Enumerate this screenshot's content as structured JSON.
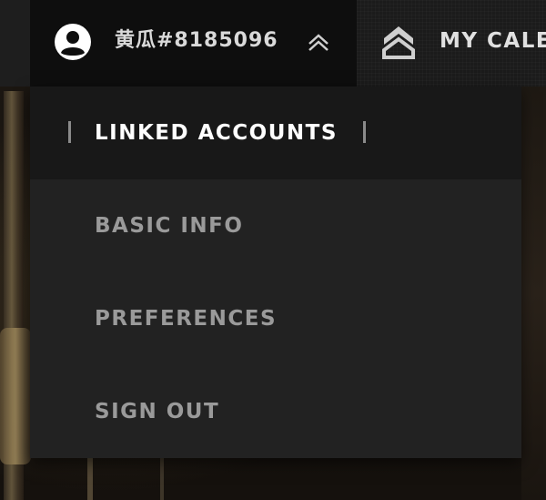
{
  "header": {
    "username": "黄瓜#8185096",
    "calendar_label": "MY CALE"
  },
  "dropdown": {
    "items": [
      {
        "label": "LINKED ACCOUNTS",
        "active": true
      },
      {
        "label": "BASIC INFO",
        "active": false
      },
      {
        "label": "PREFERENCES",
        "active": false
      },
      {
        "label": "SIGN OUT",
        "active": false
      }
    ]
  },
  "icons": {
    "avatar": "user-avatar-icon",
    "chevron": "chevron-up-icon",
    "rank": "rank-chevron-icon"
  },
  "colors": {
    "topbar": "#1b1b1b",
    "user_menu": "#0e0e0e",
    "dropdown": "#222222",
    "active_item": "#181818",
    "active_text": "#ffffff",
    "inactive_text": "#9a9a9a"
  }
}
